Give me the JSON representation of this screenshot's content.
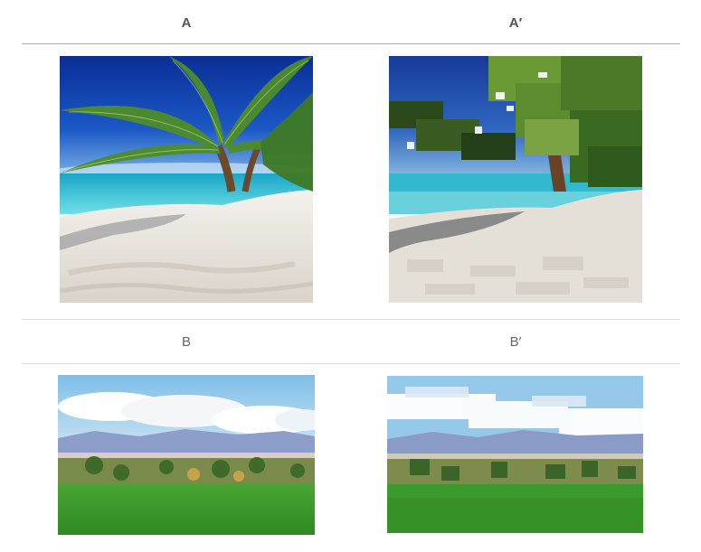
{
  "header_row_1": {
    "left": "A",
    "right": "A′"
  },
  "header_row_2": {
    "left": "B",
    "right": "B′"
  },
  "images": {
    "a": "beach-palm-photo",
    "a_prime": "beach-palm-painterly",
    "b": "meadow-mountains-photo",
    "b_prime": "meadow-mountains-painterly"
  },
  "colors": {
    "sky_deep": "#0b3aa6",
    "sea": "#2ec6d8",
    "sand": "#ece8e1",
    "palm": "#4f8a2a",
    "grass": "#3f9a2b",
    "mountain": "#8a9cc4",
    "sky_light": "#9ccdee"
  }
}
